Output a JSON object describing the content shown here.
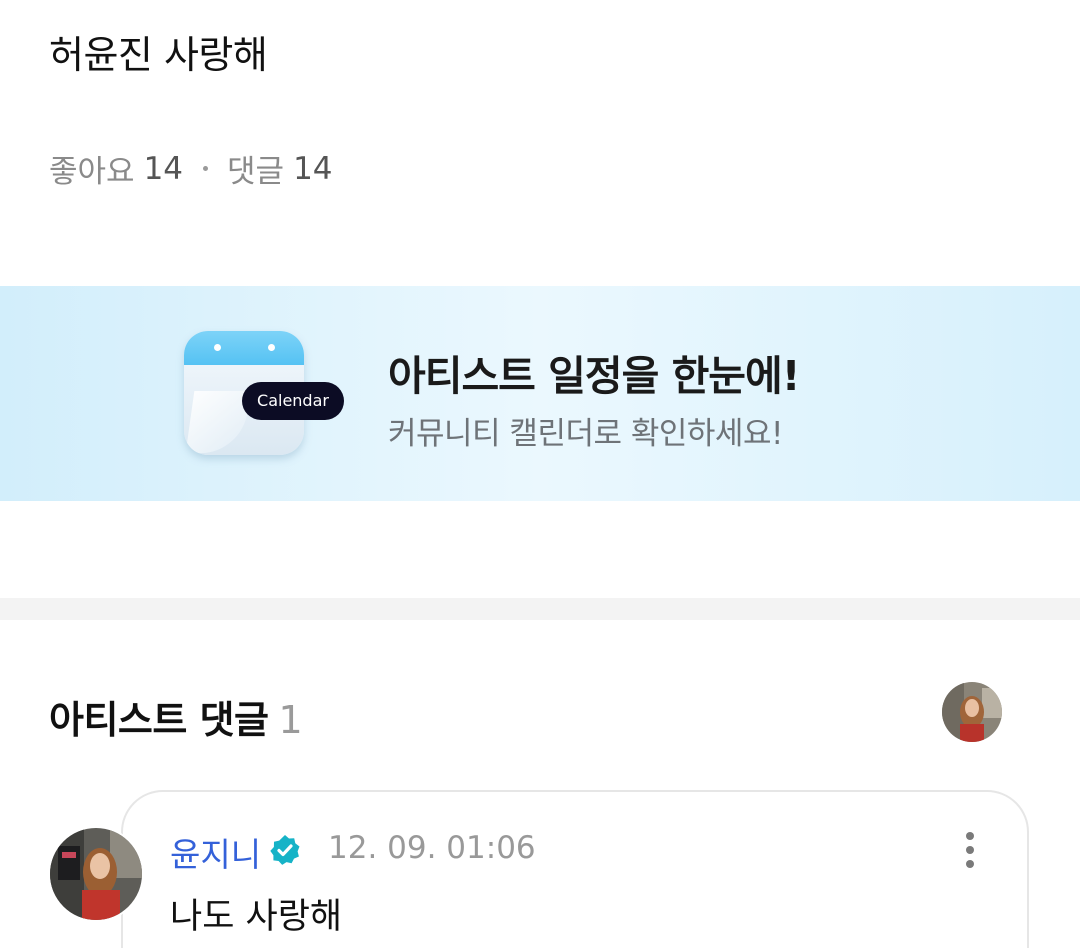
{
  "post": {
    "body": "허윤진 사랑해",
    "likes_label": "좋아요",
    "likes_count": "14",
    "comments_label": "댓글",
    "comments_count": "14"
  },
  "banner": {
    "title": "아티스트 일정을 한눈에!",
    "subtitle": "커뮤니티 캘린더로 확인하세요!",
    "pill_label": "Calendar",
    "icon": "calendar-icon",
    "accent_color": "#55c2f3"
  },
  "artist_comments": {
    "title": "아티스트 댓글",
    "count": "1",
    "avatar_icon": "artist-avatar",
    "comments": [
      {
        "author": "윤지니",
        "verified_icon": "verified-badge-icon",
        "timestamp": "12. 09. 01:06",
        "text": "나도 사랑해",
        "more_icon": "more-vertical-icon"
      }
    ]
  },
  "colors": {
    "author_blue": "#3461d9",
    "verified_teal": "#16b3c7"
  }
}
